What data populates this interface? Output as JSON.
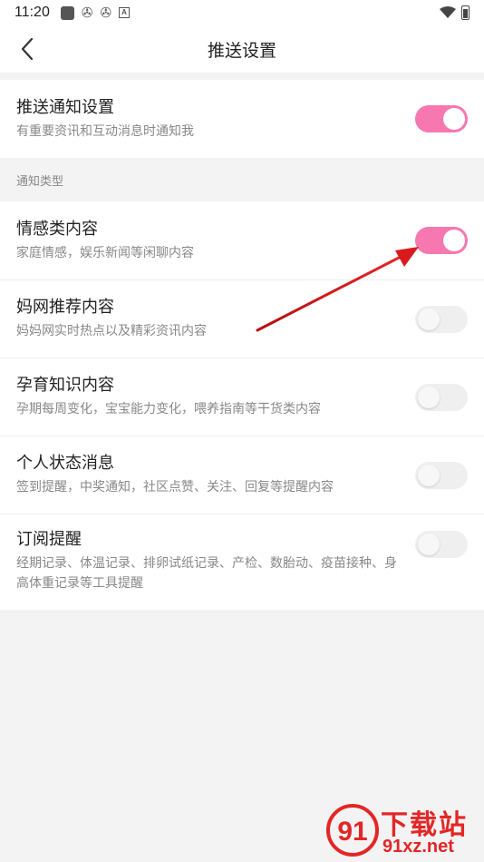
{
  "status_bar": {
    "time": "11:20",
    "icons": [
      "square-app-icon",
      "pinwheel-icon",
      "pinwheel-icon",
      "a-badge-icon"
    ],
    "right_icons": [
      "wifi-icon",
      "battery-icon"
    ]
  },
  "header": {
    "title": "推送设置",
    "back_icon": "chevron-left-icon"
  },
  "push_setting": {
    "title": "推送通知设置",
    "subtitle": "有重要资讯和互动消息时通知我",
    "enabled": true
  },
  "section_label": "通知类型",
  "items": [
    {
      "title": "情感类内容",
      "subtitle": "家庭情感，娱乐新闻等闲聊内容",
      "enabled": true
    },
    {
      "title": "妈网推荐内容",
      "subtitle": "妈妈网实时热点以及精彩资讯内容",
      "enabled": false
    },
    {
      "title": "孕育知识内容",
      "subtitle": "孕期每周变化，宝宝能力变化，喂养指南等干货类内容",
      "enabled": false
    },
    {
      "title": "个人状态消息",
      "subtitle": "签到提醒，中奖通知，社区点赞、关注、回复等提醒内容",
      "enabled": false
    },
    {
      "title": "订阅提醒",
      "subtitle": "经期记录、体温记录、排卵试纸记录、产检、数胎动、疫苗接种、身高体重记录等工具提醒",
      "enabled": false
    }
  ],
  "colors": {
    "accent": "#f777b0",
    "annotation_arrow": "#d9191c",
    "watermark": "#e32626"
  },
  "watermark": {
    "line1": "下载站",
    "line2": "91xz.net"
  }
}
